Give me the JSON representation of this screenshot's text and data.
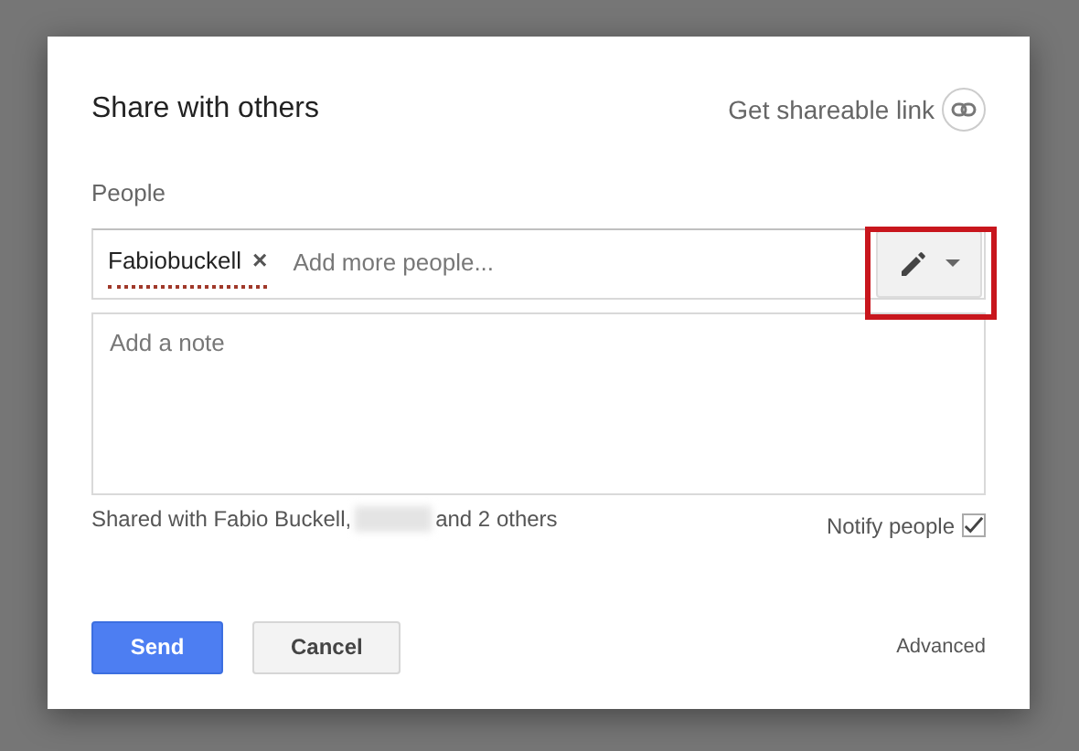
{
  "dialog": {
    "title": "Share with others",
    "shareable_link": "Get shareable link"
  },
  "people": {
    "label": "People",
    "chips": [
      {
        "name": "Fabiobuckell",
        "remove": "×"
      }
    ],
    "placeholder": "Add more people...",
    "highlighted": true
  },
  "note": {
    "placeholder": "Add a note"
  },
  "shared_with": {
    "prefix": "Shared with Fabio Buckell,",
    "redacted": true,
    "suffix": "and 2 others"
  },
  "notify": {
    "label": "Notify people",
    "checked": true
  },
  "buttons": [
    {
      "label": "Send",
      "kind": "primary"
    },
    {
      "label": "Cancel",
      "kind": "secondary"
    }
  ],
  "advanced": "Advanced"
}
